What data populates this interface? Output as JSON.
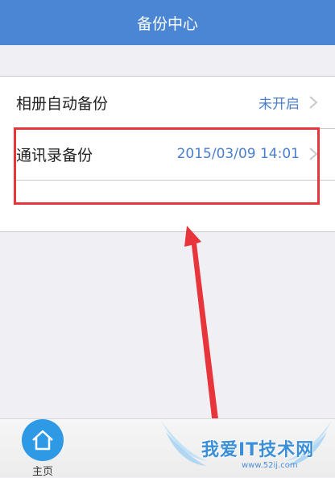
{
  "header": {
    "title": "备份中心"
  },
  "settings": {
    "rows": [
      {
        "label": "相册自动备份",
        "value": "未开启"
      },
      {
        "label": "通讯录备份",
        "value": "2015/03/09 14:01"
      }
    ]
  },
  "tabbar": {
    "home_label": "主页"
  },
  "watermark": {
    "title": "我爱IT技术网",
    "url": "www.52ij.com"
  },
  "colors": {
    "navbar": "#4a86d4",
    "value_text": "#4a7fcb",
    "highlight": "#e8353b",
    "home_button": "#2e9ae6"
  },
  "icons": {
    "row_chevron": "chevron-right-icon",
    "home": "home-icon"
  }
}
